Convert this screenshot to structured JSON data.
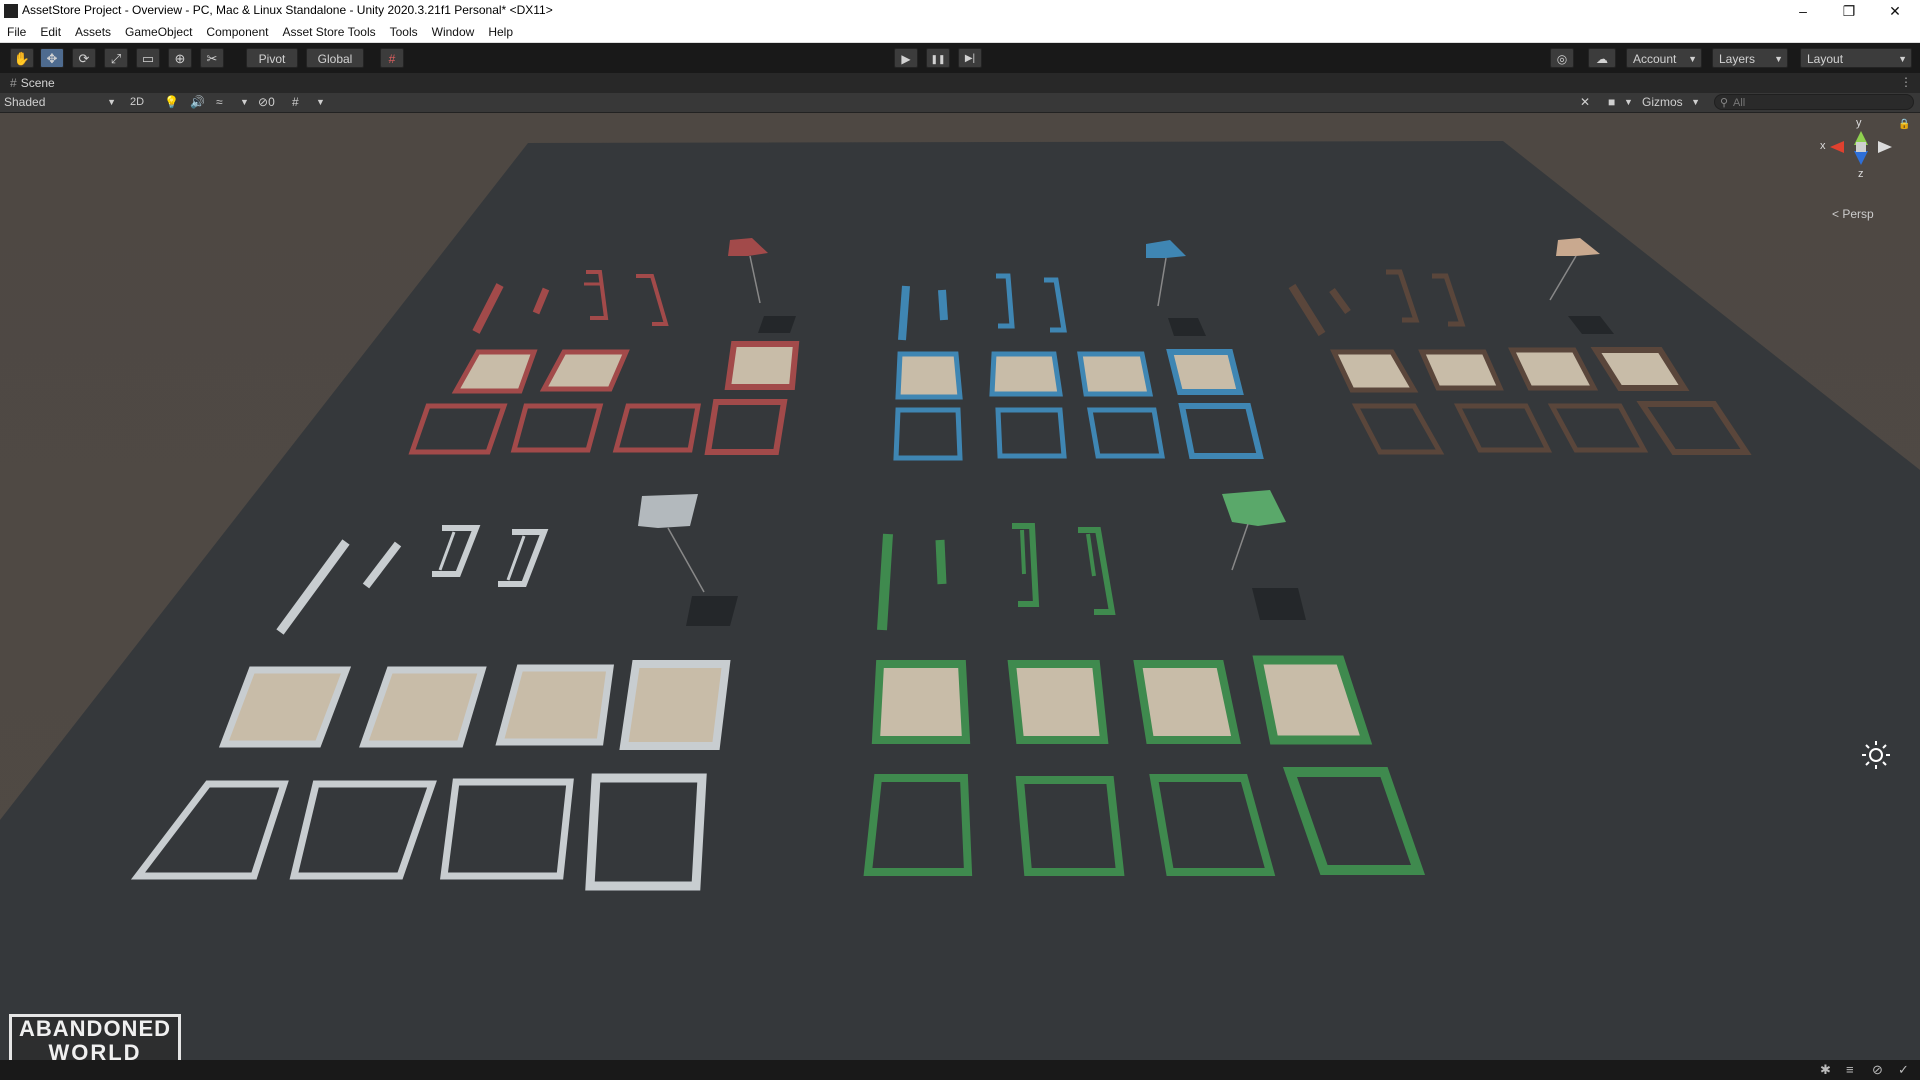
{
  "window": {
    "title": "AssetStore Project - Overview - PC, Mac & Linux Standalone - Unity 2020.3.21f1 Personal* <DX11>",
    "controls": {
      "minimize": "–",
      "maximize": "❐",
      "close": "✕"
    }
  },
  "menu": [
    "File",
    "Edit",
    "Assets",
    "GameObject",
    "Component",
    "Asset Store Tools",
    "Tools",
    "Window",
    "Help"
  ],
  "toolbar": {
    "tools": [
      {
        "icon": "hand-icon",
        "glyph": "✋"
      },
      {
        "icon": "move-icon",
        "glyph": "✥"
      },
      {
        "icon": "rotate-icon",
        "glyph": "⟳"
      },
      {
        "icon": "scale-icon",
        "glyph": "⤢"
      },
      {
        "icon": "rect-tool-icon",
        "glyph": "▭"
      },
      {
        "icon": "transform-icon",
        "glyph": "⊕"
      },
      {
        "icon": "custom-tool-icon",
        "glyph": "✂"
      }
    ],
    "pivot": "Pivot",
    "global": "Global",
    "snap_icon": "grid-snap-icon",
    "play_icon": "▶",
    "pause_icon": "❚❚",
    "step_icon": "▶|",
    "account": "Account",
    "layers": "Layers",
    "layout": "Layout"
  },
  "scene_tab": {
    "label": "Scene",
    "icon": "#"
  },
  "scene_toolbar": {
    "shading": "Shaded",
    "mode_2d": "2D",
    "hidden_count": "0",
    "gizmos": "Gizmos",
    "search_placeholder": "All"
  },
  "gizmo": {
    "y": "y",
    "x": "x",
    "z": "z",
    "projection": "< Persp"
  },
  "logo": {
    "line1": "ABANDONED",
    "line2": "WORLD"
  },
  "colors": {
    "red": "#a24a4a",
    "blue": "#3f86b3",
    "brown": "#5a463b",
    "white": "#c8cdd0",
    "green": "#3f8a4e",
    "sand": "#c8bca8",
    "ground": "#34373a",
    "sky": "#4d4742"
  }
}
